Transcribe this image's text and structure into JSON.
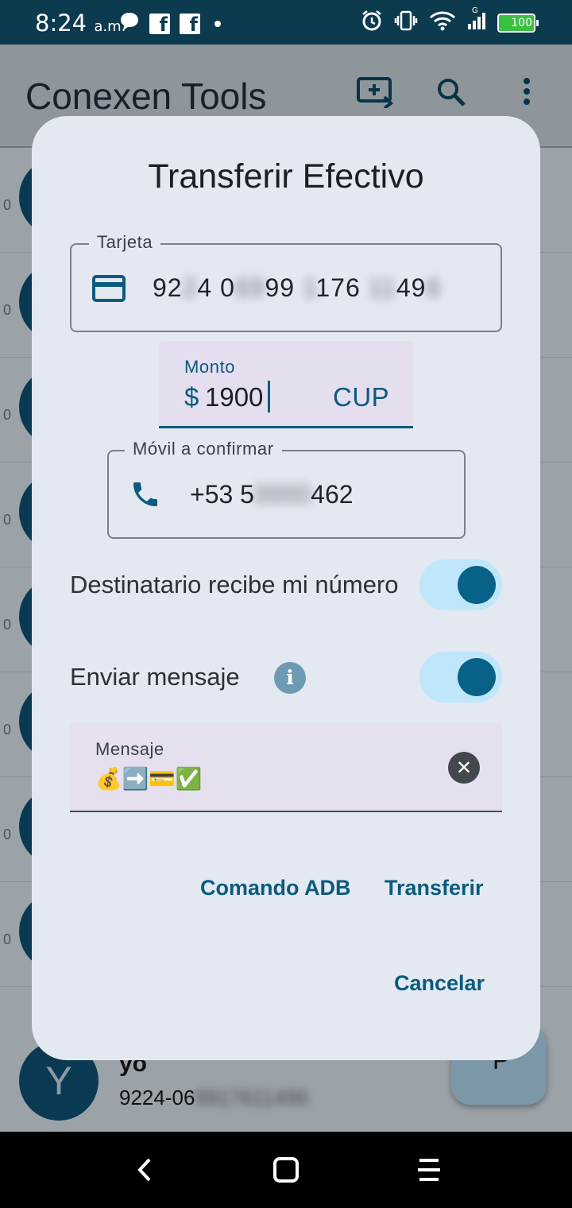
{
  "status_bar": {
    "time": "8:24",
    "time_suffix": "a.m.",
    "battery_level": "100",
    "network_label": "G"
  },
  "app": {
    "title": "Conexen Tools",
    "list_row_value": "0",
    "last_contact": {
      "avatar_letter": "Y",
      "name": "yo",
      "number_visible": "9224-06",
      "number_obscured": "9917611496"
    },
    "fab_glyph": "P"
  },
  "dialog": {
    "title": "Transferir Efectivo",
    "card_field": {
      "label": "Tarjeta",
      "segments": [
        {
          "text": "92",
          "obscured": false
        },
        {
          "text": "2",
          "obscured": true
        },
        {
          "text": "4 0",
          "obscured": false
        },
        {
          "text": "69",
          "obscured": true
        },
        {
          "text": "99 ",
          "obscured": false
        },
        {
          "text": "1",
          "obscured": true
        },
        {
          "text": "176 ",
          "obscured": false
        },
        {
          "text": "11",
          "obscured": true
        },
        {
          "text": "49",
          "obscured": false
        },
        {
          "text": "6",
          "obscured": true
        }
      ]
    },
    "amount_field": {
      "label": "Monto",
      "prefix": "$",
      "value": "1900",
      "suffix": "CUP"
    },
    "phone_field": {
      "label": "Móvil a confirmar",
      "prefix": "+53 5",
      "obscured": "0000",
      "suffix": "462"
    },
    "toggle_share_number": {
      "label": "Destinatario recibe mi número",
      "on": true
    },
    "toggle_send_message": {
      "label": "Enviar mensaje",
      "on": true
    },
    "info_icon_glyph": "i",
    "message_field": {
      "label": "Mensaje",
      "value": "💰➡️💳✅"
    },
    "buttons": {
      "adb": "Comando ADB",
      "transfer": "Transferir",
      "cancel": "Cancelar"
    }
  },
  "colors": {
    "primary": "#0a5b7e",
    "status_bar": "#0c3a4e",
    "dialog_bg": "#e3e8f1",
    "switch_track": "#bfe6fb",
    "switch_thumb": "#086287"
  }
}
